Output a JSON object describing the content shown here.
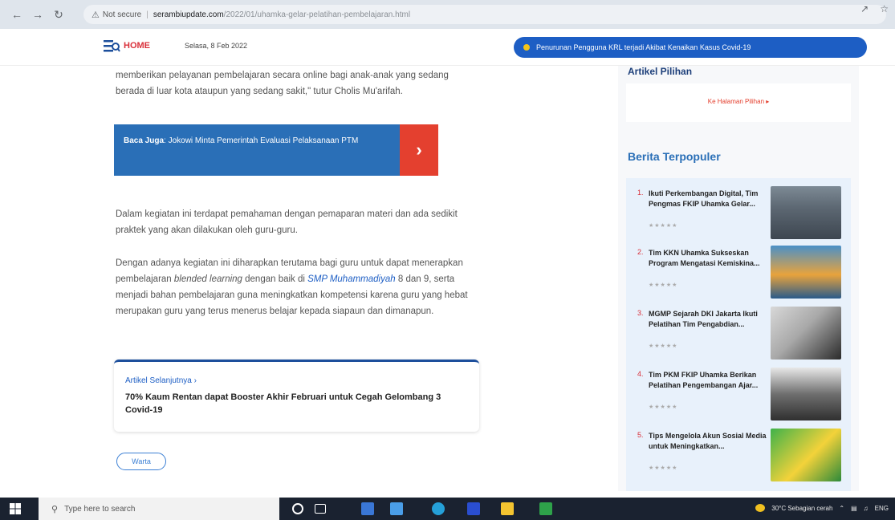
{
  "browser": {
    "security_label": "Not secure",
    "url_host": "serambiupdate.com",
    "url_path": "/2022/01/uhamka-gelar-pelatihan-pembelajaran.html"
  },
  "header": {
    "home_label": "HOME",
    "date": "Selasa, 8 Feb 2022",
    "ticker_text": "Penurunan Pengguna KRL terjadi Akibat Kenaikan Kasus Covid-19"
  },
  "article": {
    "para1": "memberikan pelayanan pembelajaran secara online bagi anak-anak yang sedang berada di luar kota ataupun yang sedang sakit,\" tutur Cholis Mu'arifah.",
    "baca_label": "Baca Juga",
    "baca_text": ": Jokowi Minta Pemerintah Evaluasi Pelaksanaan PTM",
    "para2": "Dalam kegiatan ini terdapat pemahaman dengan pemaparan materi dan ada sedikit praktek yang akan dilakukan oleh guru-guru.",
    "para3_a": "Dengan adanya kegiatan ini diharapkan terutama bagi guru untuk dapat menerapkan pembelajaran ",
    "para3_em": "blended learning",
    "para3_b": " dengan baik di ",
    "para3_link": "SMP Muhammadiyah",
    "para3_c": " 8 dan 9, serta menjadi bahan pembelajaran guna meningkatkan kompetensi karena guru yang hebat merupakan guru yang terus menerus belajar kepada siapaun dan dimanapun.",
    "next_label": "Artikel Selanjutnya ›",
    "next_title": "70% Kaum Rentan dapat Booster Akhir Februari untuk Cegah Gelombang 3 Covid-19",
    "tag": "Warta"
  },
  "sidebar": {
    "artikel_title": "Artikel Pilihan",
    "pilihan_link": "Ke Halaman Pilihan ▸",
    "terpopuler_title": "Berita Terpopuler",
    "items": [
      {
        "num": "1.",
        "title": "Ikuti Perkembangan Digital, Tim Pengmas FKIP Uhamka Gelar...",
        "stars": "★★★★★"
      },
      {
        "num": "2.",
        "title": "Tim KKN Uhamka Sukseskan Program Mengatasi Kemiskina...",
        "stars": "★★★★★"
      },
      {
        "num": "3.",
        "title": "MGMP Sejarah DKI Jakarta Ikuti Pelatihan Tim Pengabdian...",
        "stars": "★★★★★"
      },
      {
        "num": "4.",
        "title": "Tim PKM FKIP Uhamka Berikan Pelatihan Pengembangan Ajar...",
        "stars": "★★★★★"
      },
      {
        "num": "5.",
        "title": "Tips Mengelola Akun Sosial Media untuk Meningkatkan...",
        "stars": "★★★★★"
      }
    ]
  },
  "taskbar": {
    "search_placeholder": "Type here to search",
    "weather": "30°C  Sebagian cerah",
    "lang": "ENG"
  },
  "colors": {
    "brand_blue": "#2a6fb7",
    "accent_red": "#e4402f",
    "ticker_blue": "#1d5ec4"
  }
}
